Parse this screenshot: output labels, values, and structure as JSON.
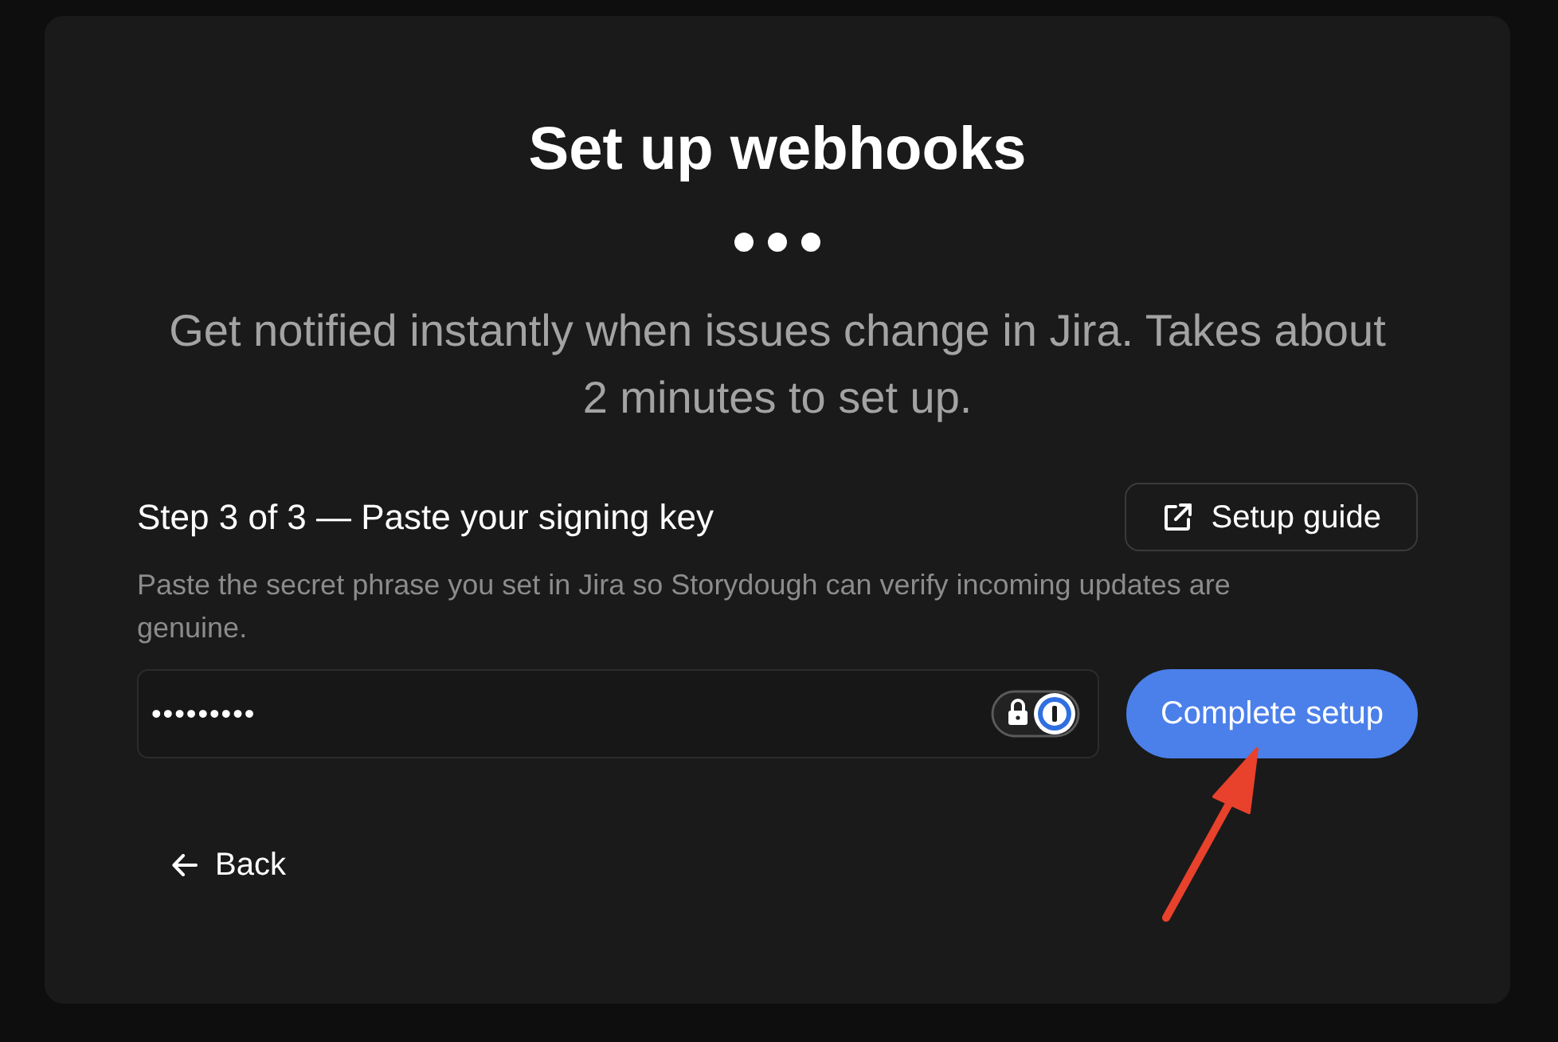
{
  "card": {
    "title": "Set up webhooks",
    "subtitle": "Get notified instantly when issues change in Jira. Takes about 2 minutes to set up."
  },
  "step": {
    "label": "Step 3 of 3 — Paste your signing key",
    "guide_button": "Setup guide",
    "description": "Paste the secret phrase you set in Jira so Storydough can verify incoming updates are genuine.",
    "key_field": {
      "value": "•••••••••"
    },
    "submit_button": "Complete setup"
  },
  "back_link": "Back"
}
